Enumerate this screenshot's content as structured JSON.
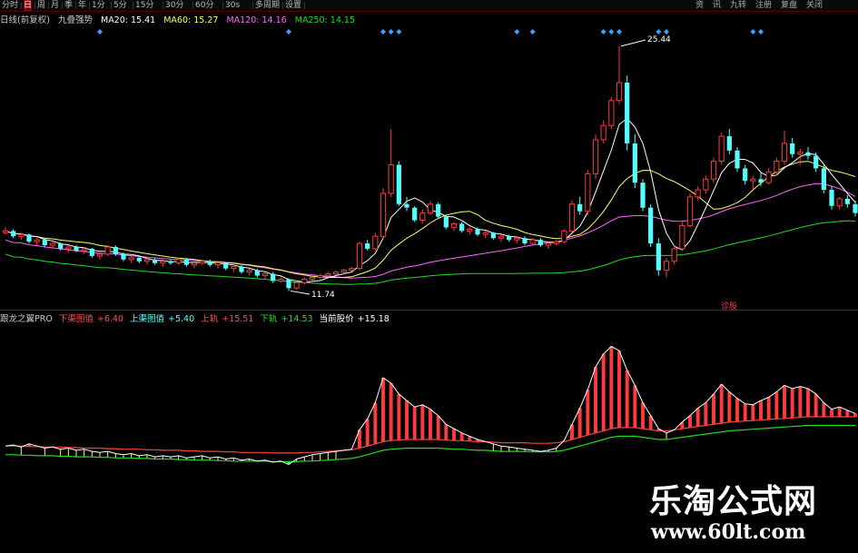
{
  "toolbar": {
    "items": [
      "分时",
      "日",
      "周",
      "月",
      "季",
      "年",
      "1分",
      "5分",
      "15分",
      "30分",
      "60分",
      "30s",
      "多周期",
      "设置"
    ],
    "active_index": 1,
    "window_buttons": [
      "资",
      "讯",
      "九转",
      "注册",
      "复盘",
      "关闭"
    ]
  },
  "main_legend": {
    "indicator": "日线(前复权)",
    "name": "九叠强势",
    "ma20": "MA20: 15.41",
    "ma60": "MA60: 15.27",
    "ma120": "MA120: 14.16",
    "ma250": "MA250: 14.15"
  },
  "sub_legend": {
    "name": "跟龙之翼PRO",
    "lower_band_label": "下渠图值",
    "lower_band": "+6.40",
    "upper_band_label": "上渠图值",
    "upper_band": "+5.40",
    "up_label": "上轨",
    "up": "+15.51",
    "down_label": "下轨",
    "down": "+14.53",
    "price_label": "当前股价",
    "price": "+15.18"
  },
  "annotations": {
    "high": "25.44",
    "low": "11.74",
    "badge": "诊股"
  },
  "watermark": {
    "title": "乐淘公式网",
    "url": "www.60lt.com"
  },
  "colors": {
    "up": "#ff3a3a",
    "down": "#54ffff",
    "ma20": "#ffffff",
    "ma60": "#ffff66",
    "ma120": "#ff66ff",
    "ma250": "#22dd22",
    "diamond": "#3aa0ff",
    "divider": "#a00000"
  },
  "chart_data": {
    "type": "candlestick",
    "main_panel": {
      "ylim": [
        11.0,
        26.5
      ],
      "candles": [
        [
          15.0,
          15.3,
          14.9,
          15.1
        ],
        [
          15.1,
          15.2,
          14.7,
          14.8
        ],
        [
          14.8,
          15.0,
          14.6,
          14.9
        ],
        [
          14.9,
          14.95,
          14.4,
          14.5
        ],
        [
          14.5,
          14.7,
          14.3,
          14.6
        ],
        [
          14.6,
          14.7,
          14.2,
          14.3
        ],
        [
          14.3,
          14.5,
          14.1,
          14.4
        ],
        [
          14.4,
          14.45,
          14.0,
          14.1
        ],
        [
          14.1,
          14.3,
          13.9,
          14.2
        ],
        [
          14.2,
          14.3,
          13.9,
          14.0
        ],
        [
          14.0,
          14.2,
          13.8,
          14.1
        ],
        [
          14.1,
          14.15,
          13.6,
          13.7
        ],
        [
          13.7,
          13.9,
          13.5,
          13.8
        ],
        [
          13.8,
          14.3,
          13.7,
          14.2
        ],
        [
          14.2,
          14.3,
          13.7,
          13.8
        ],
        [
          13.8,
          13.9,
          13.4,
          13.5
        ],
        [
          13.5,
          13.7,
          13.3,
          13.6
        ],
        [
          13.6,
          13.7,
          13.3,
          13.4
        ],
        [
          13.4,
          13.6,
          13.2,
          13.5
        ],
        [
          13.5,
          13.6,
          13.2,
          13.3
        ],
        [
          13.3,
          13.5,
          13.1,
          13.4
        ],
        [
          13.4,
          13.5,
          13.2,
          13.3
        ],
        [
          13.3,
          13.6,
          13.2,
          13.5
        ],
        [
          13.5,
          13.6,
          13.1,
          13.2
        ],
        [
          13.2,
          13.4,
          13.0,
          13.3
        ],
        [
          13.3,
          13.5,
          13.2,
          13.4
        ],
        [
          13.4,
          13.5,
          13.1,
          13.2
        ],
        [
          13.2,
          13.4,
          13.0,
          13.3
        ],
        [
          13.3,
          13.35,
          12.9,
          13.0
        ],
        [
          13.0,
          13.2,
          12.8,
          13.1
        ],
        [
          13.1,
          13.2,
          12.7,
          12.8
        ],
        [
          12.8,
          13.0,
          12.6,
          12.9
        ],
        [
          12.9,
          13.0,
          12.5,
          12.6
        ],
        [
          12.6,
          12.8,
          12.4,
          12.7
        ],
        [
          12.7,
          12.8,
          12.2,
          12.3
        ],
        [
          12.3,
          12.5,
          12.2,
          12.4
        ],
        [
          12.4,
          12.45,
          11.74,
          11.9
        ],
        [
          11.9,
          12.3,
          11.8,
          12.2
        ],
        [
          12.2,
          12.5,
          12.1,
          12.4
        ],
        [
          12.4,
          12.6,
          12.3,
          12.5
        ],
        [
          12.5,
          12.7,
          12.4,
          12.6
        ],
        [
          12.6,
          12.8,
          12.5,
          12.7
        ],
        [
          12.7,
          12.9,
          12.6,
          12.8
        ],
        [
          12.8,
          13.0,
          12.7,
          12.9
        ],
        [
          12.9,
          13.1,
          12.8,
          13.0
        ],
        [
          13.0,
          14.5,
          12.9,
          14.4
        ],
        [
          14.4,
          14.6,
          14.0,
          14.1
        ],
        [
          14.1,
          15.0,
          14.0,
          14.8
        ],
        [
          14.8,
          17.5,
          14.7,
          17.2
        ],
        [
          17.2,
          20.8,
          17.0,
          18.8
        ],
        [
          18.8,
          19.0,
          16.5,
          16.6
        ],
        [
          16.6,
          17.0,
          16.2,
          16.4
        ],
        [
          16.4,
          16.5,
          15.6,
          15.7
        ],
        [
          15.7,
          16.3,
          15.5,
          16.1
        ],
        [
          16.1,
          16.8,
          16.0,
          16.6
        ],
        [
          16.6,
          16.7,
          15.8,
          15.9
        ],
        [
          15.9,
          16.0,
          15.2,
          15.3
        ],
        [
          15.3,
          15.6,
          15.1,
          15.5
        ],
        [
          15.5,
          15.6,
          15.0,
          15.1
        ],
        [
          15.1,
          15.3,
          14.9,
          15.2
        ],
        [
          15.2,
          15.3,
          14.8,
          14.9
        ],
        [
          14.9,
          15.1,
          14.7,
          15.0
        ],
        [
          15.0,
          15.05,
          14.6,
          14.7
        ],
        [
          14.7,
          14.9,
          14.5,
          14.8
        ],
        [
          14.8,
          14.9,
          14.5,
          14.6
        ],
        [
          14.6,
          14.8,
          14.4,
          14.7
        ],
        [
          14.7,
          14.8,
          14.3,
          14.4
        ],
        [
          14.4,
          14.7,
          14.3,
          14.6
        ],
        [
          14.6,
          14.7,
          14.2,
          14.3
        ],
        [
          14.3,
          14.5,
          14.1,
          14.4
        ],
        [
          14.4,
          14.6,
          14.3,
          14.5
        ],
        [
          14.5,
          15.2,
          14.4,
          15.1
        ],
        [
          15.1,
          16.8,
          15.0,
          16.6
        ],
        [
          16.6,
          17.0,
          16.0,
          16.2
        ],
        [
          16.2,
          18.5,
          16.0,
          18.3
        ],
        [
          18.3,
          20.5,
          18.0,
          20.2
        ],
        [
          20.2,
          21.3,
          20.0,
          21.0
        ],
        [
          21.0,
          22.6,
          20.8,
          22.4
        ],
        [
          22.4,
          25.44,
          22.2,
          23.4
        ],
        [
          23.4,
          23.8,
          19.6,
          20.0
        ],
        [
          20.0,
          20.5,
          17.5,
          17.8
        ],
        [
          17.8,
          18.0,
          16.2,
          16.4
        ],
        [
          16.4,
          16.6,
          14.2,
          14.4
        ],
        [
          14.4,
          14.7,
          12.6,
          12.9
        ],
        [
          12.9,
          13.6,
          12.5,
          13.4
        ],
        [
          13.4,
          14.3,
          13.2,
          14.1
        ],
        [
          14.1,
          15.6,
          14.0,
          15.4
        ],
        [
          15.4,
          17.2,
          15.3,
          17.0
        ],
        [
          17.0,
          17.6,
          16.8,
          17.4
        ],
        [
          17.4,
          18.2,
          17.2,
          18.0
        ],
        [
          18.0,
          19.2,
          17.8,
          19.0
        ],
        [
          19.0,
          20.6,
          18.8,
          20.4
        ],
        [
          20.4,
          20.8,
          19.4,
          19.6
        ],
        [
          19.6,
          19.8,
          18.4,
          18.6
        ],
        [
          18.6,
          18.8,
          17.7,
          17.9
        ],
        [
          17.9,
          18.2,
          17.4,
          18.0
        ],
        [
          18.0,
          18.4,
          17.6,
          17.8
        ],
        [
          17.8,
          18.6,
          17.7,
          18.4
        ],
        [
          18.4,
          19.2,
          18.2,
          19.0
        ],
        [
          19.0,
          20.7,
          18.8,
          20.0
        ],
        [
          20.0,
          20.3,
          19.2,
          19.4
        ],
        [
          19.4,
          19.7,
          18.8,
          19.5
        ],
        [
          19.5,
          19.8,
          19.1,
          19.3
        ],
        [
          19.3,
          19.5,
          18.4,
          18.6
        ],
        [
          18.6,
          18.8,
          17.2,
          17.4
        ],
        [
          17.4,
          17.6,
          16.3,
          16.5
        ],
        [
          16.5,
          17.0,
          16.3,
          16.9
        ],
        [
          16.9,
          17.1,
          16.4,
          16.6
        ],
        [
          16.6,
          16.8,
          15.9,
          16.1
        ]
      ]
    },
    "sub_panel": {
      "ylim": [
        0,
        13
      ],
      "ticks_up": [
        2.0,
        2.1,
        1.9,
        2.2,
        2.0,
        1.8,
        1.9,
        1.7,
        1.8,
        1.6,
        1.7,
        1.5,
        1.4,
        1.5,
        1.3,
        1.2,
        1.3,
        1.1,
        1.2,
        1.0,
        1.1,
        1.0,
        1.1,
        0.9,
        1.0,
        1.1,
        0.9,
        1.0,
        0.8,
        0.9,
        0.7,
        0.8,
        0.6,
        0.7,
        0.5,
        0.6,
        0.3,
        0.8,
        1.0,
        1.2,
        1.3,
        1.4,
        1.5,
        1.6,
        1.7,
        3.5,
        4.5,
        6.0,
        8.3,
        7.8,
        6.8,
        6.2,
        5.6,
        5.8,
        5.4,
        4.8,
        4.0,
        3.6,
        3.2,
        2.9,
        2.6,
        2.4,
        2.2,
        2.0,
        1.9,
        1.8,
        1.7,
        1.6,
        1.5,
        1.6,
        1.8,
        2.5,
        4.0,
        5.5,
        7.2,
        9.3,
        10.5,
        11.2,
        10.8,
        9.0,
        7.6,
        6.0,
        4.8,
        3.6,
        3.2,
        3.5,
        4.2,
        4.8,
        5.5,
        6.0,
        6.8,
        7.7,
        7.0,
        6.4,
        5.9,
        5.8,
        6.2,
        6.5,
        7.0,
        7.6,
        7.3,
        7.5,
        7.3,
        6.8,
        6.0,
        5.4,
        5.6,
        5.3,
        5.0
      ],
      "upper_line": [
        2.0,
        2.0,
        2.0,
        1.95,
        1.95,
        1.9,
        1.9,
        1.9,
        1.85,
        1.85,
        1.8,
        1.8,
        1.8,
        1.75,
        1.75,
        1.7,
        1.7,
        1.7,
        1.65,
        1.65,
        1.6,
        1.6,
        1.6,
        1.55,
        1.55,
        1.5,
        1.5,
        1.5,
        1.45,
        1.45,
        1.4,
        1.4,
        1.4,
        1.4,
        1.35,
        1.35,
        1.35,
        1.35,
        1.4,
        1.4,
        1.45,
        1.5,
        1.55,
        1.6,
        1.65,
        1.8,
        2.0,
        2.2,
        2.4,
        2.5,
        2.55,
        2.6,
        2.6,
        2.6,
        2.6,
        2.6,
        2.55,
        2.5,
        2.5,
        2.45,
        2.4,
        2.4,
        2.35,
        2.3,
        2.3,
        2.3,
        2.3,
        2.25,
        2.25,
        2.25,
        2.3,
        2.4,
        2.6,
        2.8,
        3.0,
        3.2,
        3.4,
        3.6,
        3.7,
        3.7,
        3.7,
        3.6,
        3.5,
        3.4,
        3.4,
        3.5,
        3.6,
        3.7,
        3.8,
        3.9,
        4.0,
        4.1,
        4.2,
        4.25,
        4.3,
        4.35,
        4.4,
        4.45,
        4.5,
        4.55,
        4.6,
        4.65,
        4.7,
        4.7,
        4.7,
        4.7,
        4.7,
        4.7,
        4.7
      ],
      "lower_line": [
        1.2,
        1.2,
        1.15,
        1.15,
        1.1,
        1.1,
        1.1,
        1.05,
        1.05,
        1.0,
        1.0,
        1.0,
        0.95,
        0.95,
        0.9,
        0.9,
        0.9,
        0.85,
        0.85,
        0.8,
        0.8,
        0.8,
        0.75,
        0.75,
        0.7,
        0.7,
        0.7,
        0.65,
        0.65,
        0.6,
        0.6,
        0.6,
        0.6,
        0.6,
        0.55,
        0.55,
        0.55,
        0.55,
        0.6,
        0.6,
        0.65,
        0.7,
        0.75,
        0.8,
        0.85,
        1.0,
        1.2,
        1.4,
        1.6,
        1.7,
        1.75,
        1.8,
        1.8,
        1.8,
        1.8,
        1.8,
        1.75,
        1.7,
        1.7,
        1.65,
        1.6,
        1.6,
        1.55,
        1.5,
        1.5,
        1.5,
        1.5,
        1.45,
        1.45,
        1.45,
        1.5,
        1.6,
        1.8,
        2.0,
        2.2,
        2.4,
        2.6,
        2.8,
        2.9,
        2.9,
        2.9,
        2.8,
        2.7,
        2.6,
        2.6,
        2.7,
        2.8,
        2.9,
        3.0,
        3.1,
        3.2,
        3.3,
        3.4,
        3.45,
        3.5,
        3.55,
        3.6,
        3.65,
        3.7,
        3.75,
        3.8,
        3.85,
        3.9,
        3.9,
        3.9,
        3.9,
        3.9,
        3.9,
        3.9
      ]
    }
  }
}
